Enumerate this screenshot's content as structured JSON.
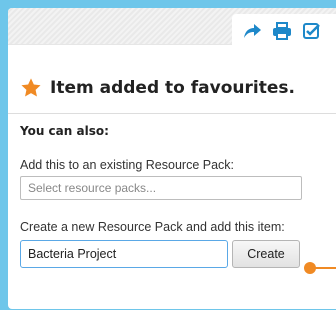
{
  "toolbar": {
    "icons": [
      "share-arrow-icon",
      "print-icon",
      "checkbox-icon"
    ],
    "icon_color": "#1e88c9"
  },
  "dialog": {
    "title": "Item added to favourites.",
    "star_color": "#f08a24",
    "also_label": "You can also:",
    "existing_label": "Add this to an existing Resource Pack:",
    "existing_placeholder": "Select resource packs...",
    "new_label": "Create a new Resource Pack and add this item:",
    "new_value": "Bacteria Project",
    "create_button": "Create"
  },
  "colors": {
    "background": "#6ec6ea",
    "accent": "#f08a24",
    "focus_border": "#5aa8e6"
  }
}
